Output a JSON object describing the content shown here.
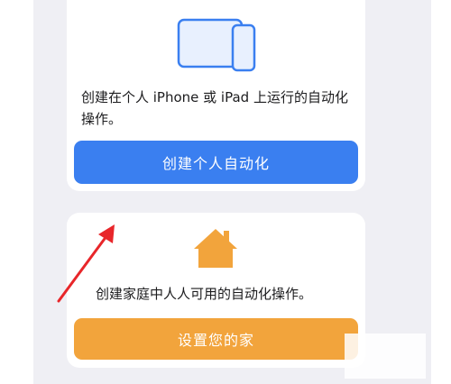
{
  "personal_card": {
    "icon": "iphone-ipad-icon",
    "description": "创建在个人 iPhone 或 iPad 上运行的自动化操作。",
    "button_label": "创建个人自动化"
  },
  "home_card": {
    "icon": "house-icon",
    "description": "创建家庭中人人可用的自动化操作。",
    "button_label": "设置您的家"
  },
  "annotation": {
    "icon": "red-arrow-icon"
  },
  "colors": {
    "background": "#efeff4",
    "card": "#ffffff",
    "personal_button": "#3a7ff0",
    "home_button": "#f2a43c",
    "device_outline": "#3a7ff0",
    "house": "#f2a43c",
    "arrow": "#e8262a"
  }
}
